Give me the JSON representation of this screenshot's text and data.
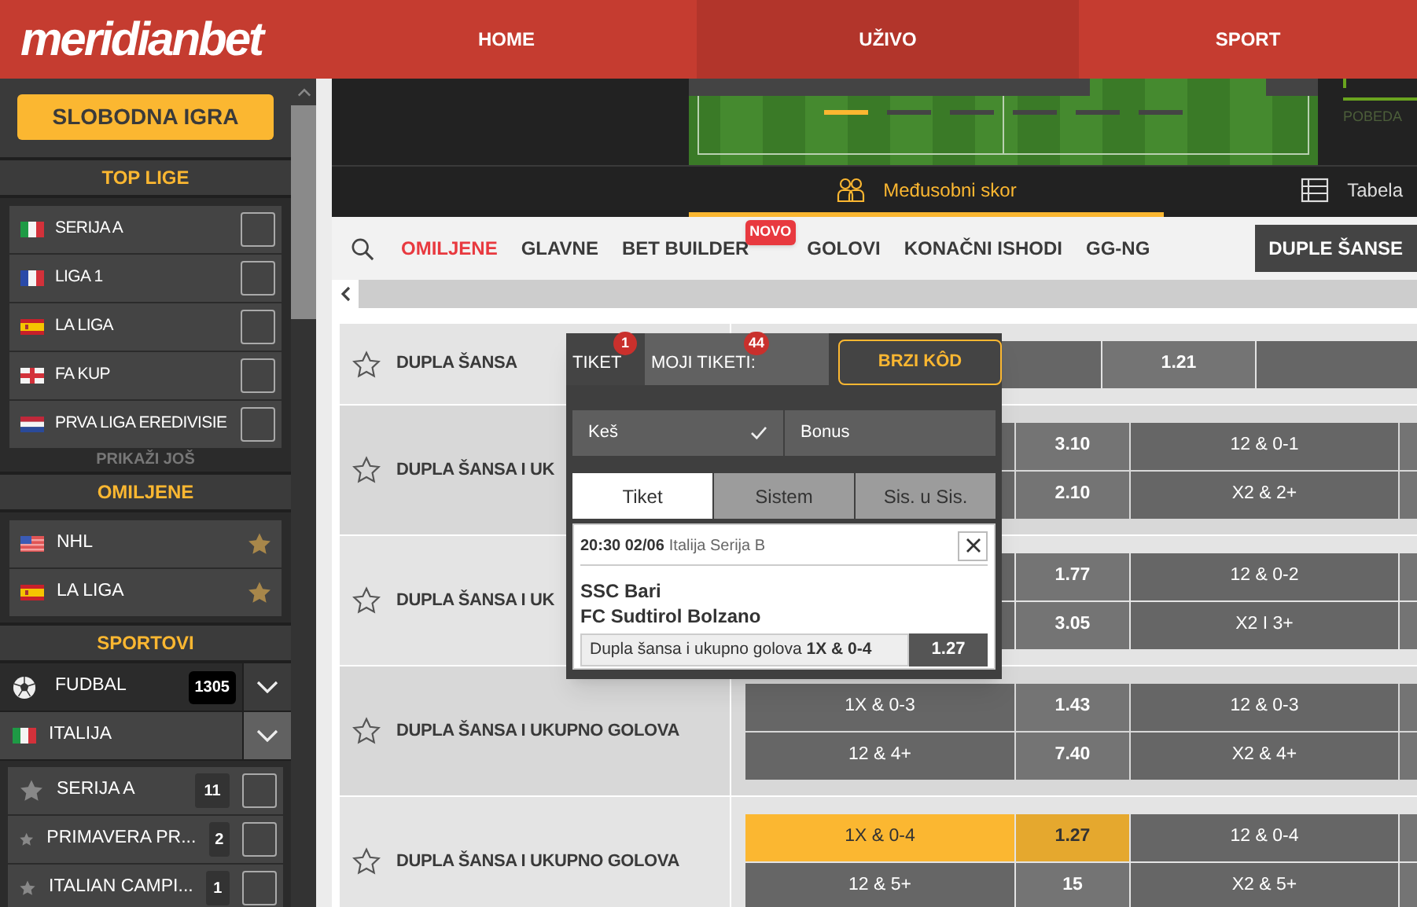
{
  "header": {
    "logo": "meridianbet",
    "nav": [
      {
        "label": "HOME",
        "selected": false
      },
      {
        "label": "UŽIVO",
        "selected": true
      },
      {
        "label": "SPORT",
        "selected": false
      }
    ]
  },
  "sidebar": {
    "free_play_button": "SLOBODNA IGRA",
    "top_leagues": {
      "title": "TOP LIGE",
      "more": "PRIKAŽI JOŠ",
      "items": [
        {
          "kind": "italy",
          "name": "SERIJA A",
          "checked": false
        },
        {
          "kind": "france",
          "name": "LIGA 1",
          "checked": false
        },
        {
          "kind": "spain",
          "name": "LA LIGA",
          "checked": false
        },
        {
          "kind": "england",
          "name": "FA KUP",
          "checked": false
        },
        {
          "kind": "netherlands",
          "name": "PRVA LIGA EREDIVISIE",
          "checked": false
        }
      ]
    },
    "favorites": {
      "title": "OMILJENE",
      "items": [
        {
          "kind": "usa",
          "name": "NHL",
          "starred": true
        },
        {
          "kind": "spain",
          "name": "LA LIGA",
          "starred": true
        }
      ]
    },
    "sports": {
      "title": "SPORTOVI",
      "sport": {
        "name": "FUDBAL",
        "count": "1305"
      },
      "country": {
        "kind": "italy",
        "name": "ITALIJA"
      },
      "leagues": [
        {
          "name": "SERIJA A",
          "count": "11",
          "starred": false,
          "checked": false
        },
        {
          "name": "PRIMAVERA PR...",
          "count": "2",
          "starred": false,
          "checked": false
        },
        {
          "name": "ITALIAN CAMPI...",
          "count": "1",
          "starred": false,
          "checked": false
        }
      ]
    }
  },
  "stage": {
    "slides": [
      {
        "selected": true
      },
      {
        "selected": false
      },
      {
        "selected": false
      },
      {
        "selected": false
      },
      {
        "selected": false
      },
      {
        "selected": false
      }
    ],
    "result_label": "POBEDA",
    "tabs": [
      {
        "label": "Međusobni skor",
        "kind": "h2h",
        "selected": true
      },
      {
        "label": "Tabela",
        "kind": "table",
        "selected": false
      }
    ]
  },
  "market_tabs": [
    {
      "label": "OMILJENE",
      "kind": "favorite",
      "selected": false
    },
    {
      "label": "GLAVNE",
      "kind": "plain",
      "selected": false
    },
    {
      "label": "BET BUILDER",
      "kind": "plain",
      "badge": "NOVO",
      "selected": false
    },
    {
      "label": "GOLOVI",
      "kind": "plain",
      "selected": false
    },
    {
      "label": "KONAČNI ISHODI",
      "kind": "plain",
      "selected": false
    },
    {
      "label": "GG-NG",
      "kind": "plain",
      "selected": false
    },
    {
      "label": "DUPLE ŠANSE",
      "kind": "plain",
      "selected": true
    }
  ],
  "markets": [
    {
      "title": "DUPLA ŠANSA",
      "starred": false,
      "kind": "single",
      "lines": [
        [
          {
            "kind": "label",
            "selected": false
          },
          {
            "kind": "odd",
            "text": "1.21",
            "selected": false
          },
          {
            "kind": "label",
            "selected": false
          }
        ]
      ]
    },
    {
      "title": "DUPLA ŠANSA I UK",
      "starred": false,
      "kind": "double",
      "lines": [
        [
          {
            "kind": "label",
            "selected": false
          },
          {
            "kind": "odd",
            "text": "3.10",
            "selected": false
          },
          {
            "kind": "label",
            "text": "12 & 0-1",
            "selected": false
          },
          {
            "kind": "odd",
            "selected": false
          }
        ],
        [
          {
            "kind": "label",
            "selected": false
          },
          {
            "kind": "odd",
            "text": "2.10",
            "selected": false
          },
          {
            "kind": "label",
            "text": "X2 & 2+",
            "selected": false
          },
          {
            "kind": "odd",
            "selected": false
          }
        ]
      ]
    },
    {
      "title": "DUPLA ŠANSA I UK",
      "starred": false,
      "kind": "double",
      "lines": [
        [
          {
            "kind": "label",
            "selected": false
          },
          {
            "kind": "odd",
            "text": "1.77",
            "selected": false
          },
          {
            "kind": "label",
            "text": "12 & 0-2",
            "selected": false
          },
          {
            "kind": "odd",
            "selected": false
          }
        ],
        [
          {
            "kind": "label",
            "selected": false
          },
          {
            "kind": "odd",
            "text": "3.05",
            "selected": false
          },
          {
            "kind": "label",
            "text": "X2 I 3+",
            "selected": false
          },
          {
            "kind": "odd",
            "selected": false
          }
        ]
      ]
    },
    {
      "title": "DUPLA ŠANSA I UKUPNO GOLOVA",
      "starred": false,
      "kind": "double",
      "lines": [
        [
          {
            "kind": "label",
            "text": "1X & 0-3",
            "selected": false
          },
          {
            "kind": "odd",
            "text": "1.43",
            "selected": false
          },
          {
            "kind": "label",
            "text": "12 & 0-3",
            "selected": false
          },
          {
            "kind": "odd",
            "selected": false
          }
        ],
        [
          {
            "kind": "label",
            "text": "12 & 4+",
            "selected": false
          },
          {
            "kind": "odd",
            "text": "7.40",
            "selected": false
          },
          {
            "kind": "label",
            "text": "X2 & 4+",
            "selected": false
          },
          {
            "kind": "odd",
            "selected": false
          }
        ]
      ]
    },
    {
      "title": "DUPLA ŠANSA I UKUPNO GOLOVA",
      "starred": false,
      "kind": "double",
      "lines": [
        [
          {
            "kind": "label",
            "text": "1X & 0-4",
            "selected": true
          },
          {
            "kind": "odd",
            "text": "1.27",
            "selected": true
          },
          {
            "kind": "label",
            "text": "12 & 0-4",
            "selected": false
          },
          {
            "kind": "odd",
            "selected": false
          }
        ],
        [
          {
            "kind": "label",
            "text": "12 & 5+",
            "selected": false
          },
          {
            "kind": "odd",
            "text": "15",
            "selected": false
          },
          {
            "kind": "label",
            "text": "X2 & 5+",
            "selected": false
          },
          {
            "kind": "odd",
            "selected": false
          }
        ]
      ]
    }
  ],
  "ticket": {
    "tabs": [
      {
        "label": "TIKET",
        "badge": "1",
        "selected": true
      },
      {
        "label": "MOJI TIKETI:",
        "badge": "44",
        "selected": false
      }
    ],
    "quick_code_button": "BRZI KÔD",
    "payment": [
      {
        "label": "Keš",
        "selected": true
      },
      {
        "label": "Bonus",
        "selected": false
      }
    ],
    "types": [
      {
        "label": "Tiket",
        "selected": true
      },
      {
        "label": "Sistem",
        "selected": false
      },
      {
        "label": "Sis. u Sis.",
        "selected": false
      }
    ],
    "bet": {
      "time": "20:30 02/06",
      "league": "Italija Serija B",
      "home": "SSC Bari",
      "away": "FC Sudtirol Bolzano",
      "selection": "Dupla šansa i ukupno golova **1X & 0-4**",
      "odd": "1.27"
    }
  }
}
